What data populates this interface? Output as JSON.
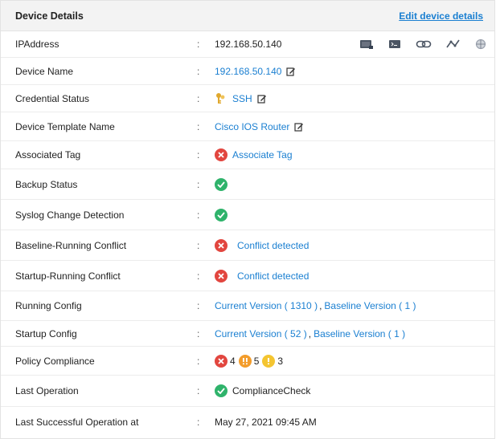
{
  "header": {
    "title": "Device Details",
    "edit_link": "Edit device details"
  },
  "rows": {
    "ip": {
      "label": "IPAddress",
      "value": "192.168.50.140"
    },
    "device_name": {
      "label": "Device Name",
      "value": "192.168.50.140"
    },
    "credential": {
      "label": "Credential Status",
      "value": "SSH"
    },
    "template": {
      "label": "Device Template Name",
      "value": "Cisco IOS Router"
    },
    "tag": {
      "label": "Associated Tag",
      "value": "Associate Tag"
    },
    "backup": {
      "label": "Backup Status"
    },
    "syslog": {
      "label": "Syslog Change Detection"
    },
    "baseline_running": {
      "label": "Baseline-Running Conflict",
      "value": "Conflict detected"
    },
    "startup_running": {
      "label": "Startup-Running Conflict",
      "value": "Conflict detected"
    },
    "running_config": {
      "label": "Running Config",
      "current": "Current Version ( 1310 )",
      "sep": ",",
      "baseline": "Baseline Version ( 1 )"
    },
    "startup_config": {
      "label": "Startup Config",
      "current": "Current Version ( 52 )",
      "sep": ",",
      "baseline": "Baseline Version ( 1 )"
    },
    "policy": {
      "label": "Policy Compliance",
      "critical": "4",
      "major": "5",
      "minor": "3"
    },
    "last_op": {
      "label": "Last Operation",
      "value": "ComplianceCheck"
    },
    "last_success": {
      "label": "Last Successful Operation at",
      "value": "May 27, 2021 09:45 AM"
    }
  },
  "colon": ":",
  "colors": {
    "link": "#1a7fd1",
    "success": "#2fb36b",
    "error": "#e2463f",
    "warning_orange": "#f39c2b",
    "warning_yellow": "#f4c531"
  },
  "icons": [
    "terminal-icon",
    "console-icon",
    "link-icon",
    "graph-icon",
    "globe-icon",
    "key-icon",
    "edit-icon",
    "check-circle-icon",
    "x-circle-icon",
    "exclamation-icon"
  ]
}
